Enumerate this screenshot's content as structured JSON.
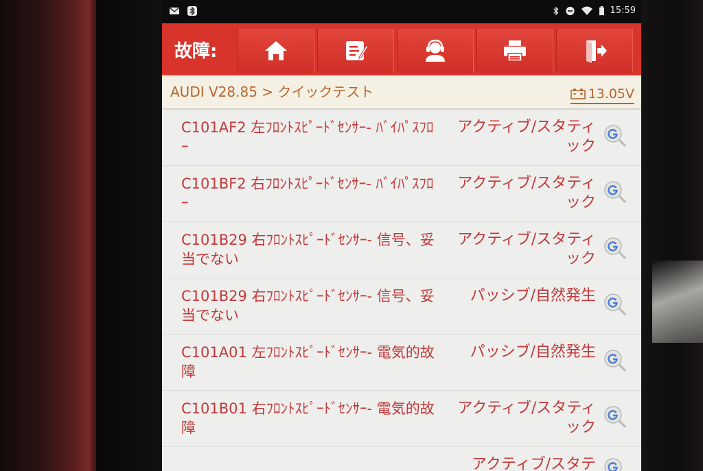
{
  "status_bar": {
    "time": "15:59",
    "icons_left": [
      "mail-icon",
      "bluetooth-app-icon"
    ],
    "icons_right": [
      "bluetooth-icon",
      "dnd-icon",
      "wifi-icon",
      "battery-icon"
    ]
  },
  "toolbar": {
    "title": "故障:",
    "buttons": [
      "home-icon",
      "report-icon",
      "support-icon",
      "print-icon",
      "exit-icon"
    ],
    "color": "#d8342c"
  },
  "breadcrumb": {
    "path": "AUDI V28.85 > クイックテスト",
    "voltage": "13.05V"
  },
  "codes": [
    {
      "code": "C101AF2 左ﾌﾛﾝﾄｽﾋﾟｰﾄﾞｾﾝｻｰ- ﾊﾞｲﾊﾟｽﾌﾛｰ",
      "status": "アクティブ/スタティック"
    },
    {
      "code": "C101BF2 右ﾌﾛﾝﾄｽﾋﾟｰﾄﾞｾﾝｻｰ- ﾊﾞｲﾊﾟｽﾌﾛｰ",
      "status": "アクティブ/スタティック"
    },
    {
      "code": "C101B29 右ﾌﾛﾝﾄｽﾋﾟｰﾄﾞｾﾝｻｰ- 信号、妥当でない",
      "status": "アクティブ/スタティック"
    },
    {
      "code": "C101B29 右ﾌﾛﾝﾄｽﾋﾟｰﾄﾞｾﾝｻｰ- 信号、妥当でない",
      "status": "パッシブ/自然発生"
    },
    {
      "code": "C101A01 左ﾌﾛﾝﾄｽﾋﾟｰﾄﾞｾﾝｻｰ- 電気的故障",
      "status": "パッシブ/自然発生"
    },
    {
      "code": "C101B01 右ﾌﾛﾝﾄｽﾋﾟｰﾄﾞｾﾝｻｰ- 電気的故障",
      "status": "アクティブ/スタティック"
    }
  ],
  "partial_status": "アクティブ/スタテ",
  "colors": {
    "accent_red": "#d8342c",
    "code_text": "#c0393a",
    "breadcrumb_text": "#b8652e"
  }
}
